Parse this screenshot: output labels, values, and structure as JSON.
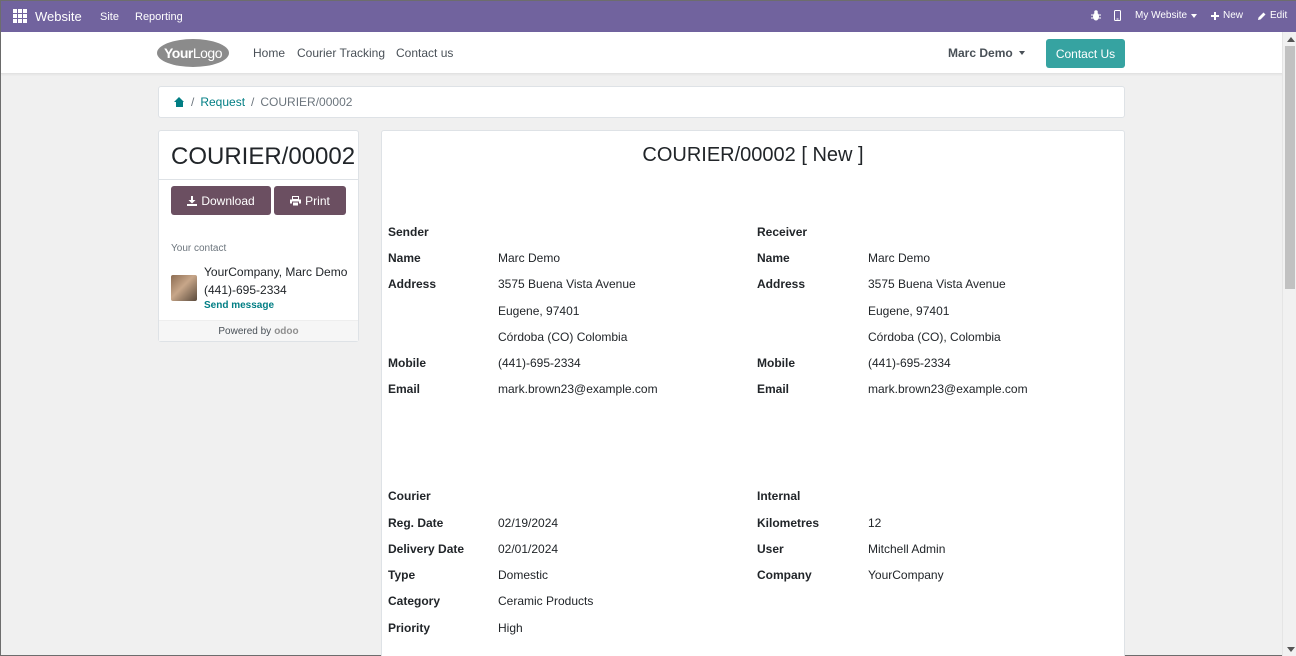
{
  "topbar": {
    "brand": "Website",
    "menu": [
      "Site",
      "Reporting"
    ],
    "my_website": "My Website",
    "new": "New",
    "edit": "Edit"
  },
  "header": {
    "logo_bold": "Your",
    "logo_thin": "Logo",
    "nav": [
      "Home",
      "Courier Tracking",
      "Contact us"
    ],
    "user": "Marc Demo",
    "contact_button": "Contact Us"
  },
  "breadcrumb": {
    "sep": "/",
    "request": "Request",
    "current": "COURIER/00002"
  },
  "sidebar": {
    "title": "COURIER/00002",
    "download": "Download",
    "print": "Print",
    "your_contact": "Your contact",
    "contact_name": "YourCompany, Marc Demo",
    "contact_phone": "(441)-695-2334",
    "send_message": "Send message",
    "powered_by": "Powered by",
    "odoo": "odoo"
  },
  "document": {
    "title": "COURIER/00002 [ New ]",
    "sender": {
      "heading": "Sender",
      "name_label": "Name",
      "name": "Marc Demo",
      "address_label": "Address",
      "address1": "3575 Buena Vista Avenue",
      "address2": "Eugene, 97401",
      "address3": "Córdoba (CO) Colombia",
      "mobile_label": "Mobile",
      "mobile": "(441)-695-2334",
      "email_label": "Email",
      "email": "mark.brown23@example.com"
    },
    "receiver": {
      "heading": "Receiver",
      "name_label": "Name",
      "name": "Marc Demo",
      "address_label": "Address",
      "address1": "3575 Buena Vista Avenue",
      "address2": "Eugene, 97401",
      "address3": "Córdoba (CO), Colombia",
      "mobile_label": "Mobile",
      "mobile": "(441)-695-2334",
      "email_label": "Email",
      "email": "mark.brown23@example.com"
    },
    "courier": {
      "heading": "Courier",
      "reg_date_label": "Reg. Date",
      "reg_date": "02/19/2024",
      "delivery_date_label": "Delivery Date",
      "delivery_date": "02/01/2024",
      "type_label": "Type",
      "type": "Domestic",
      "category_label": "Category",
      "category": "Ceramic Products",
      "priority_label": "Priority",
      "priority": "High"
    },
    "internal": {
      "heading": "Internal",
      "km_label": "Kilometres",
      "km": "12",
      "user_label": "User",
      "user": "Mitchell Admin",
      "company_label": "Company",
      "company": "YourCompany"
    }
  }
}
